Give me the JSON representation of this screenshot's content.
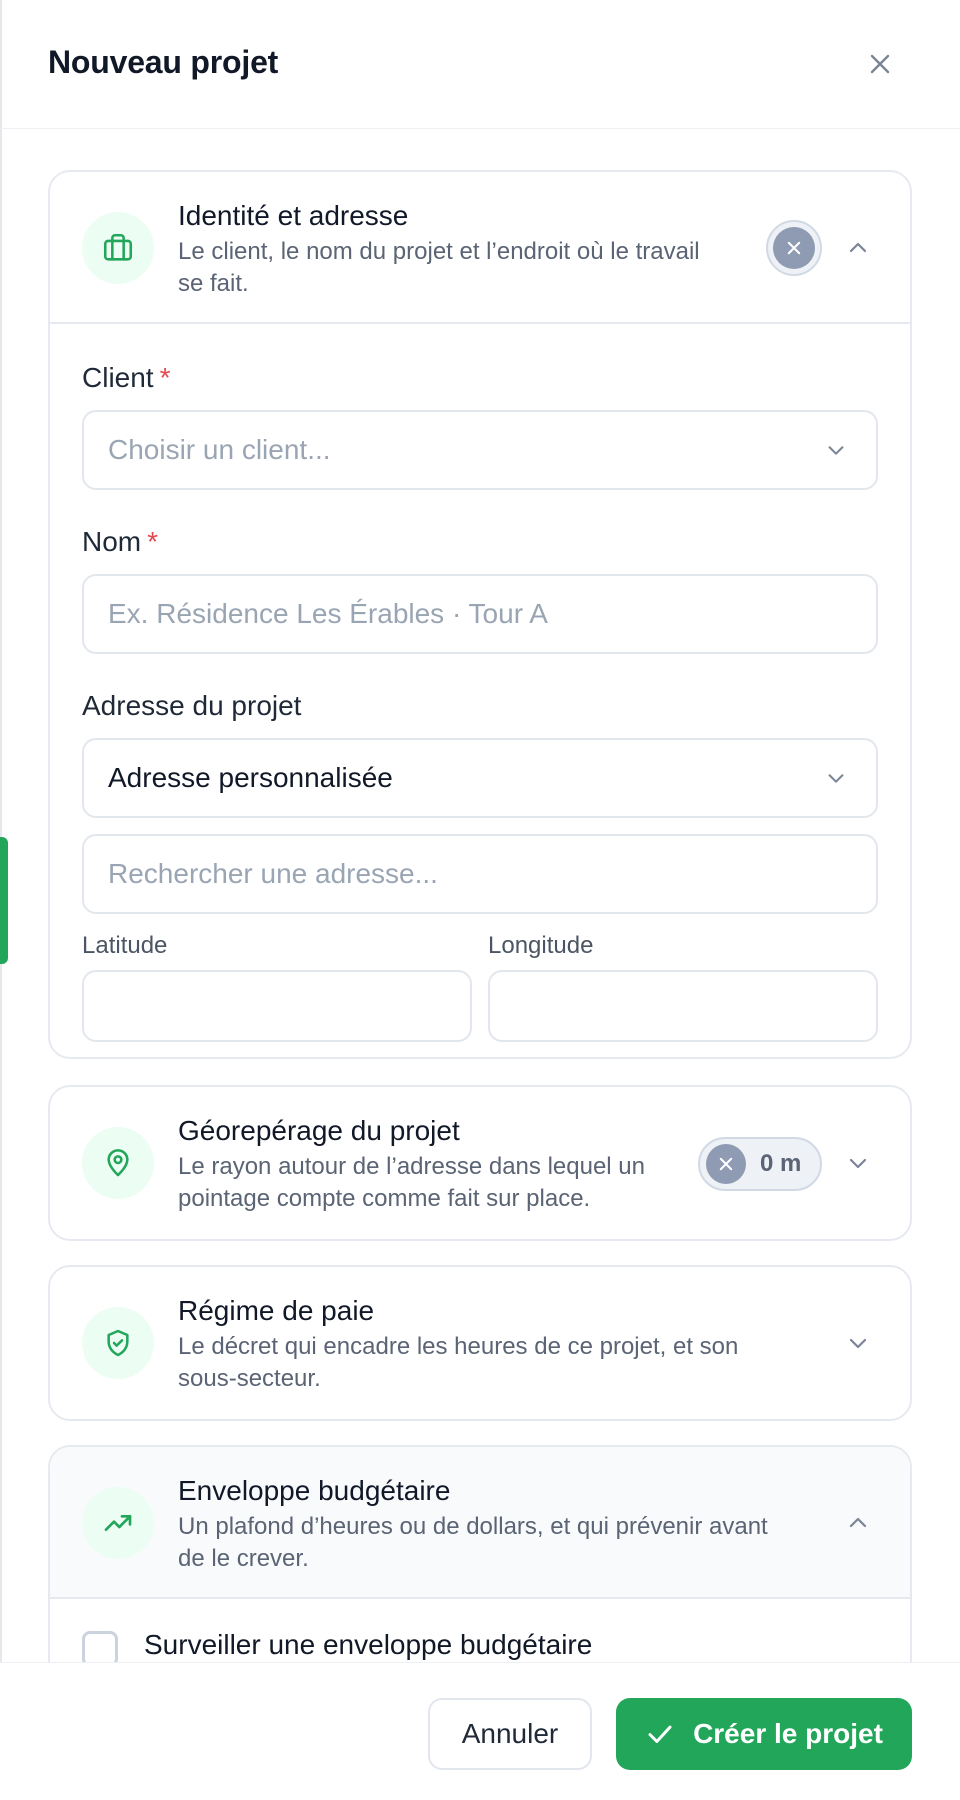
{
  "dialog": {
    "title": "Nouveau projet"
  },
  "sections": {
    "identity": {
      "title": "Identité et adresse",
      "desc_line1": "Le client, le nom du projet et l’endroit où le travail",
      "desc_line2": "se fait.",
      "icon": "briefcase-icon",
      "expanded": true
    },
    "geofence": {
      "title": "Géorepérage du projet",
      "desc_line1": "Le rayon autour de l’adresse dans lequel un",
      "desc_line2": "pointage compte comme fait sur place.",
      "radius_value": "0 m",
      "icon": "map-pin-icon",
      "expanded": false
    },
    "payroll": {
      "title": "Régime de paie",
      "desc_line1": "Le décret qui encadre les heures de ce projet, et son",
      "desc_line2": "sous-secteur.",
      "icon": "shield-check-icon",
      "expanded": false
    },
    "budget": {
      "title": "Enveloppe budgétaire",
      "desc_line1": "Un plafond d’heures ou de dollars, et qui prévenir avant",
      "desc_line2": "de le crever.",
      "icon": "trending-up-icon",
      "expanded": true,
      "checkbox_label": "Surveiller une enveloppe budgétaire",
      "checkbox_checked": false
    }
  },
  "form": {
    "client": {
      "label": "Client",
      "required_mark": "*",
      "placeholder": "Choisir un client..."
    },
    "name": {
      "label": "Nom",
      "required_mark": "*",
      "placeholder": "Ex. Résidence Les Érables · Tour A"
    },
    "address": {
      "label": "Adresse du projet",
      "selected": "Adresse personnalisée",
      "search_placeholder": "Rechercher une adresse..."
    },
    "latitude": {
      "label": "Latitude",
      "value": ""
    },
    "longitude": {
      "label": "Longitude",
      "value": ""
    }
  },
  "footer": {
    "cancel_label": "Annuler",
    "create_label": "Créer le projet"
  },
  "colors": {
    "accent": "#22a65a",
    "required": "#e5484d",
    "muted_icon": "#8f9bb3",
    "icon_bg": "#ecfdf3"
  }
}
